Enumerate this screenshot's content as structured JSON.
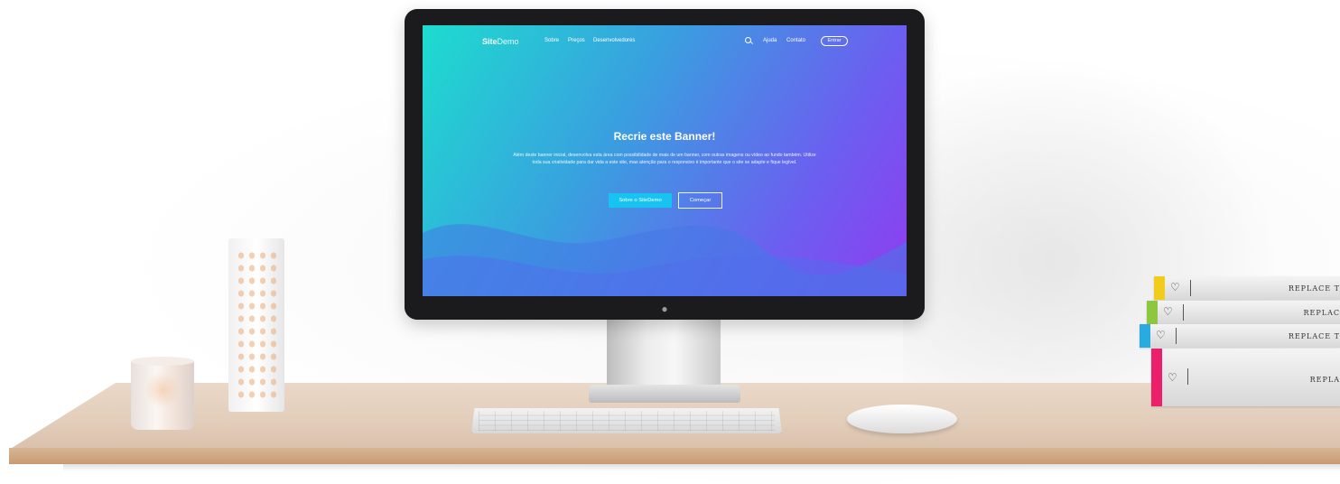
{
  "screen_site": {
    "logo_bold": "Site",
    "logo_light": "Demo",
    "nav_left": [
      "Sobre",
      "Preços",
      "Desenvolvedores"
    ],
    "nav_right": [
      "Ajuda",
      "Contato"
    ],
    "enter_label": "Entrar",
    "banner_title": "Recrie este Banner!",
    "banner_text": "Além deste banner inicial, desenvolva esta área com possibilidade de mais de um banner, com outras imagens ou vídeo ao fundo também. Utilize toda sua criatividade para dar vida a este site, mas atenção para o responsivo é importante que o site se adapte e fique legível.",
    "primary_button": "Sobre o SiteDemo",
    "secondary_button": "Começar"
  },
  "books": [
    {
      "text": "REPLACE T",
      "color": "#f2cc1c"
    },
    {
      "text": "REPLAC",
      "color": "#8dc63f"
    },
    {
      "text": "REPLACE T",
      "color": "#29abe2"
    },
    {
      "text": "REPLA",
      "color": "#ec1f6a"
    }
  ],
  "colors": {
    "gradient_start": "#1ddccf",
    "gradient_end": "#8f3cf0",
    "primary_button": "#17c3f1",
    "desk": "#e2cdba"
  }
}
